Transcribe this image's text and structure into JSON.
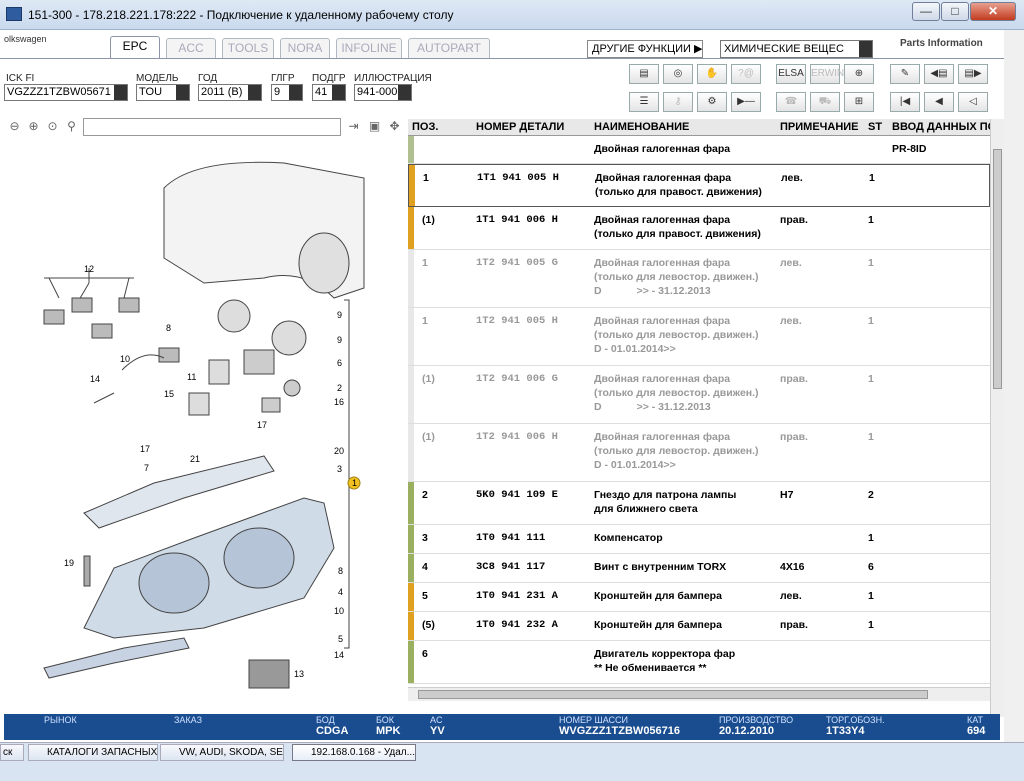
{
  "window": {
    "title": "151-300 - 178.218.221.178:222 - Подключение к удаленному рабочему столу",
    "min": "—",
    "max": "□",
    "close": "✕"
  },
  "app": {
    "logo_text": "olkswagen",
    "brand": "Parts Information",
    "tabs": [
      "EPC",
      "ACC",
      "TOOLS",
      "NORA",
      "INFOLINE",
      "AUTOPART"
    ],
    "other_functions_label": "ДРУГИЕ ФУНКЦИИ ▶",
    "other_functions_value": "ХИМИЧЕСКИЕ ВЕЩЕС",
    "filters": {
      "vin_label": "ICK FI",
      "vin_value": "VGZZZ1TZBW05671",
      "model_label": "МОДЕЛЬ",
      "model_value": "TOU",
      "year_label": "ГОД",
      "year_value": "2011 (B)",
      "group_label": "ГЛГР",
      "group_value": "9",
      "subgroup_label": "ПОДГР",
      "subgroup_value": "41",
      "illustration_label": "ИЛЛЮСТРАЦИЯ",
      "illustration_value": "941-000"
    },
    "toolbar_row1": [
      "print-icon",
      "cd-icon",
      "handshake-icon",
      "query-icon",
      "elsa-icon",
      "erwin-icon",
      "cart-add-icon",
      "pin-icon",
      "prev-page-icon",
      "next-page-icon"
    ],
    "toolbar_row2": [
      "list-icon",
      "key-icon",
      "motorbike-icon",
      "play-dash-icon",
      "phone-icon",
      "car-icon",
      "cart-icon",
      "first-icon",
      "back-icon",
      "left-icon"
    ],
    "toolbar_labels": {
      "elsa": "ELSA",
      "erwin": "ERWIN"
    },
    "grid": {
      "headers": [
        "ПОЗ.",
        "НОМЕР ДЕТАЛИ",
        "НАИМЕНОВАНИЕ",
        "ПРИМЕЧАНИЕ",
        "ST",
        "ВВОД ДАННЫХ ПО"
      ],
      "rows": [
        {
          "pos": "",
          "part": "",
          "name": "Двойная галогенная фара",
          "note": "",
          "st": "",
          "input": "PR-8ID",
          "gray": false,
          "bar": "#b0c090"
        },
        {
          "pos": "1",
          "part": "1T1 941 005 H",
          "name": "Двойная галогенная фара\n(только для правост. движения)",
          "note": "лев.",
          "st": "1",
          "input": "",
          "gray": false,
          "bar": "#e0a020"
        },
        {
          "pos": "(1)",
          "part": "1T1 941 006 H",
          "name": "Двойная галогенная фара\n(только для правост. движения)",
          "note": "прав.",
          "st": "1",
          "input": "",
          "gray": false,
          "bar": "#e0a020"
        },
        {
          "pos": "1",
          "part": "1T2 941 005 G",
          "name": "Двойная галогенная фара\n(только для левостор. движен.)\nD            >> - 31.12.2013",
          "note": "лев.",
          "st": "1",
          "input": "",
          "gray": true,
          "bar": "#e8e8e8"
        },
        {
          "pos": "1",
          "part": "1T2 941 005 H",
          "name": "Двойная галогенная фара\n(только для левостор. движен.)\nD - 01.01.2014>>",
          "note": "лев.",
          "st": "1",
          "input": "",
          "gray": true,
          "bar": "#e8e8e8"
        },
        {
          "pos": "(1)",
          "part": "1T2 941 006 G",
          "name": "Двойная галогенная фара\n(только для левостор. движен.)\nD            >> - 31.12.2013",
          "note": "прав.",
          "st": "1",
          "input": "",
          "gray": true,
          "bar": "#e8e8e8"
        },
        {
          "pos": "(1)",
          "part": "1T2 941 006 H",
          "name": "Двойная галогенная фара\n(только для левостор. движен.)\nD - 01.01.2014>>",
          "note": "прав.",
          "st": "1",
          "input": "",
          "gray": true,
          "bar": "#e8e8e8"
        },
        {
          "pos": "2",
          "part": "5K0 941 109 E",
          "name": "Гнездо для патрона лампы\nдля ближнего света",
          "note": "H7",
          "st": "2",
          "input": "",
          "gray": false,
          "bar": "#9ab060"
        },
        {
          "pos": "3",
          "part": "1T0 941 111",
          "name": "Компенсатор",
          "note": "",
          "st": "1",
          "input": "",
          "gray": false,
          "bar": "#9ab060"
        },
        {
          "pos": "4",
          "part": "3C8 941 117",
          "name": "Винт с внутренним TORX",
          "note": "4X16",
          "st": "6",
          "input": "",
          "gray": false,
          "bar": "#9ab060"
        },
        {
          "pos": "5",
          "part": "1T0 941 231 A",
          "name": "Кронштейн для бампера",
          "note": "лев.",
          "st": "1",
          "input": "",
          "gray": false,
          "bar": "#e0a020"
        },
        {
          "pos": "(5)",
          "part": "1T0 941 232 A",
          "name": "Кронштейн для бампера",
          "note": "прав.",
          "st": "1",
          "input": "",
          "gray": false,
          "bar": "#e0a020"
        },
        {
          "pos": "6",
          "part": "",
          "name": "Двигатель корректора фар\n** Не обменивается **",
          "note": "",
          "st": "",
          "input": "",
          "gray": false,
          "bar": "#9ab060"
        }
      ]
    },
    "status": [
      {
        "label": "РЫНОК",
        "value": ""
      },
      {
        "label": "ЗАКАЗ",
        "value": ""
      },
      {
        "label": "БОД",
        "value": "CDGA"
      },
      {
        "label": "БОК",
        "value": "MPK"
      },
      {
        "label": "AC",
        "value": "YV"
      },
      {
        "label": "НОМЕР ШАССИ",
        "value": "WVGZZZ1TZBW056716"
      },
      {
        "label": "ПРОИЗВОДСТВО",
        "value": "20.12.2010"
      },
      {
        "label": "ТОРГ.ОБОЗН.",
        "value": "1T33Y4"
      },
      {
        "label": "КАТ",
        "value": "694"
      }
    ],
    "illustration_callouts": [
      "12",
      "8",
      "10",
      "14",
      "15",
      "11",
      "9",
      "9",
      "6",
      "2",
      "16",
      "17",
      "17",
      "7",
      "21",
      "20",
      "3",
      "1",
      "19",
      "8",
      "4",
      "10",
      "5",
      "14",
      "13"
    ]
  },
  "taskbar": {
    "items": [
      "ск",
      "КАТАЛОГИ ЗАПАСНЫХ ...",
      "VW, AUDI, SKODA, SEAT",
      "192.168.0.168 - Удал..."
    ]
  }
}
